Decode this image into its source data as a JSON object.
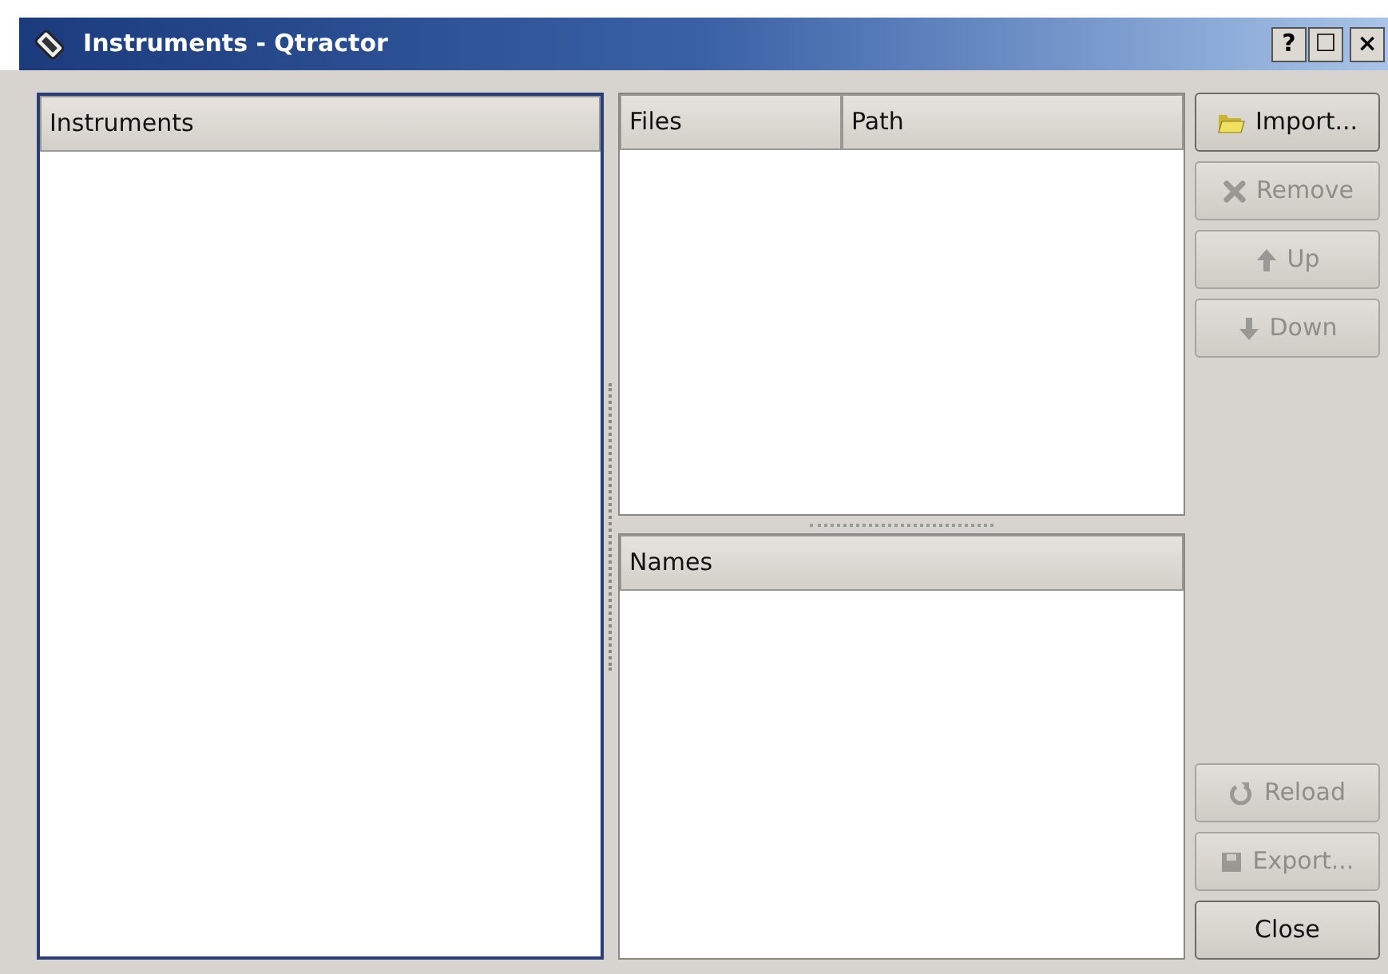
{
  "window": {
    "title": "Instruments - Qtractor",
    "controls": [
      {
        "kind": "help",
        "label": "?"
      },
      {
        "kind": "maximize",
        "label": "☐"
      },
      {
        "kind": "close",
        "label": "×"
      }
    ]
  },
  "instruments": {
    "columns": [
      "Instruments"
    ],
    "focused": true
  },
  "files": {
    "columns": [
      "Files",
      "Path"
    ]
  },
  "names": {
    "columns": [
      "Names"
    ]
  },
  "buttons_top": [
    {
      "label": "Import...",
      "kind": "folder",
      "disabled": false
    },
    {
      "label": "Remove",
      "kind": "remove",
      "disabled": true
    },
    {
      "label": "Up",
      "kind": "up",
      "disabled": true
    },
    {
      "label": "Down",
      "kind": "down",
      "disabled": true
    }
  ],
  "buttons_bottom": [
    {
      "label": "Reload",
      "kind": "reload",
      "disabled": true
    },
    {
      "label": "Export...",
      "kind": "save",
      "disabled": true
    },
    {
      "label": "Close",
      "kind": "plain",
      "disabled": false
    }
  ]
}
